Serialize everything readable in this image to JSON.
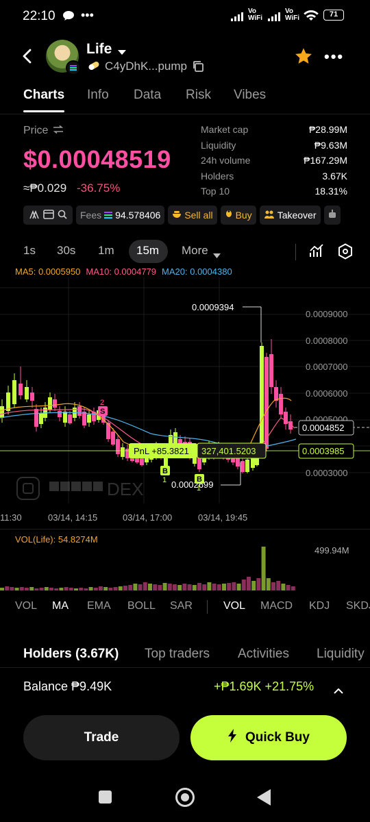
{
  "status_bar": {
    "time": "22:10",
    "battery": "71",
    "net1": "Vo WiFi",
    "net2": "Vo WiFi"
  },
  "header": {
    "token_name": "Life",
    "contract": "C4yDhK...pump"
  },
  "tabs": [
    "Charts",
    "Info",
    "Data",
    "Risk",
    "Vibes"
  ],
  "price": {
    "label": "Price",
    "value": "$0.00048519",
    "fiat": "≈₱0.029",
    "change": "-36.75%"
  },
  "stats": [
    {
      "label": "Market cap",
      "value": "₱28.99M"
    },
    {
      "label": "Liquidity",
      "value": "₱9.63M"
    },
    {
      "label": "24h volume",
      "value": "₱167.29M"
    },
    {
      "label": "Holders",
      "value": "3.67K"
    },
    {
      "label": "Top 10",
      "value": "18.31%"
    }
  ],
  "chips": {
    "fees_label": "Fees",
    "fees_value": "94.578406",
    "sell_all": "Sell all",
    "buy": "Buy",
    "takeover": "Takeover"
  },
  "timeframes": [
    "1s",
    "30s",
    "1m",
    "15m",
    "More"
  ],
  "ma": {
    "ma5": "MA5: 0.0005950",
    "ma10": "MA10: 0.0004779",
    "ma20": "MA20: 0.0004380"
  },
  "chart": {
    "y_labels": [
      "0.0009000",
      "0.0008000",
      "0.0007000",
      "0.0006000",
      "0.0005000",
      "0.0003000"
    ],
    "high_label": "0.0009394",
    "low_label": "0.0002699",
    "current_price": "0.0004852",
    "pnl_line": "0.0003985",
    "pnl_text": "PnL +85.3821",
    "holding_text": "327,401.5203",
    "x_labels": [
      "11:30",
      "03/14, 14:15",
      "03/14, 17:00",
      "03/14, 19:45"
    ],
    "watermark": "DEX",
    "marker_s": "2",
    "marker_b1": "1",
    "marker_b2": "1"
  },
  "volume": {
    "label": "VOL(Life): 54.8274M",
    "max_label": "499.94M"
  },
  "indicators_left": [
    "VOL",
    "MA",
    "EMA",
    "BOLL",
    "SAR"
  ],
  "indicators_right": [
    "VOL",
    "MACD",
    "KDJ",
    "SKDJ"
  ],
  "holder_tabs": [
    "Holders (3.67K)",
    "Top traders",
    "Activities",
    "Liquidity"
  ],
  "balance": {
    "label": "Balance ₱9.49K",
    "pnl": "+₱1.69K +21.75%"
  },
  "actions": {
    "trade": "Trade",
    "quick_buy": "Quick Buy"
  },
  "colors": {
    "accent": "#c5ff3c",
    "down": "#ff4fa3",
    "up": "#c5ff3c"
  }
}
